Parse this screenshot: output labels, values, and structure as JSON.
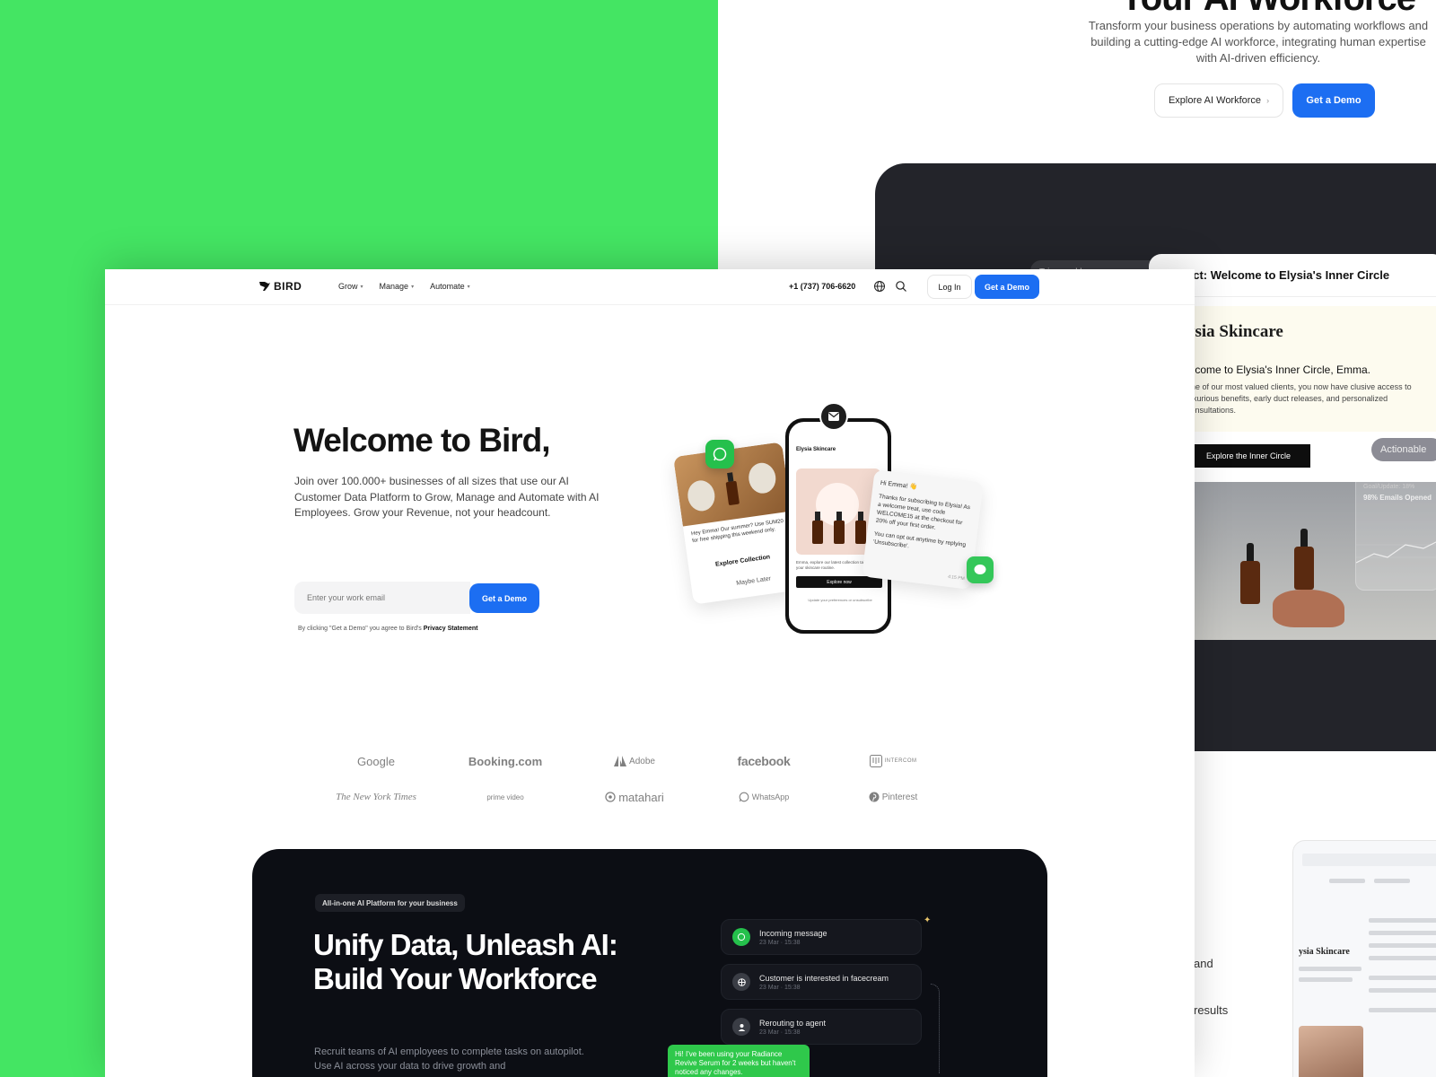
{
  "back_page": {
    "heading": "Your AI Workforce",
    "subtitle": "Transform your business operations by automating workflows and building a cutting-edge AI workforce, integrating human expertise with AI-driven efficiency.",
    "explore_label": "Explore AI Workforce",
    "demo_label": "Get a Demo",
    "email_preview": {
      "tab_label": "Triggered by",
      "subject": "ect: Welcome to Elysia's Inner Circle",
      "brand": "ysia Skincare",
      "welcome": "elcome to Elysia's Inner Circle, Emma.",
      "body": "one of our most valued clients, you now have clusive access to luxurious benefits, early duct releases, and personalized consultations.",
      "cta": "Explore the Inner Circle"
    },
    "actionable_pill": "Actionable",
    "stat_card": {
      "label": "Goal/Update: 18%",
      "value": "98% Emails Opened"
    },
    "lower_text_1": "and",
    "lower_text_2": "results",
    "panel_brand": "ysia Skincare"
  },
  "nav": {
    "logo": "BIRD",
    "menu": [
      {
        "label": "Grow"
      },
      {
        "label": "Manage"
      },
      {
        "label": "Automate"
      }
    ],
    "phone": "+1 (737) 706-6620",
    "login": "Log In",
    "demo": "Get a Demo"
  },
  "hero": {
    "title": "Welcome to Bird,",
    "subtitle": "Join over 100.000+ businesses of all sizes that use our AI Customer Data Platform to Grow, Manage and Automate with AI Employees. Grow your Revenue, not your headcount.",
    "email_placeholder": "Enter your work email",
    "button": "Get a Demo",
    "legal_prefix": "By clicking \"Get a Demo\" you agree to Bird's",
    "legal_link": "Privacy Statement"
  },
  "mockup": {
    "left_card_text": "Hey Emma! Our summer? Use SUM20 for free shipping this weekend only.",
    "left_card_link": "Explore Collection",
    "left_card_link2": "Maybe Later",
    "phone_sender": "Elysia Skincare",
    "phone_text": "Emma, explore our latest collection tailored to your skincare routine.",
    "phone_button": "Explore now",
    "phone_footer": "Update your preferences or unsubscribe",
    "right_card_hi": "Hi Emma! 👋",
    "right_card_body": "Thanks for subscribing to Elysia! As a welcome treat, use code WELCOME15 at the checkout for 20% off your first order.",
    "right_card_optout": "You can opt out anytime by replying 'Unsubscribe'.",
    "right_card_time": "4:15 PM"
  },
  "logos": [
    {
      "name": "Google"
    },
    {
      "name": "Booking.com"
    },
    {
      "name": "Adobe"
    },
    {
      "name": "facebook"
    },
    {
      "name": "INTERCOM"
    },
    {
      "name": "The New York Times"
    },
    {
      "name": "prime video"
    },
    {
      "name": "matahari"
    },
    {
      "name": "WhatsApp"
    },
    {
      "name": "Pinterest"
    }
  ],
  "platform": {
    "pill": "All-in-one AI Platform for your business",
    "title": "Unify Data, Unleash AI: Build Your Workforce",
    "subtitle": "Recruit teams of AI employees to complete tasks on autopilot. Use AI across your data to drive growth and",
    "events": [
      {
        "title": "Incoming message",
        "time": "23 Mar · 15:38",
        "icon": "whatsapp-icon",
        "color": "#25c04c"
      },
      {
        "title": "Customer is interested in facecream",
        "time": "23 Mar · 15:38",
        "icon": "openai-icon",
        "color": "#3a3d45"
      },
      {
        "title": "Rerouting to agent",
        "time": "23 Mar · 15:38",
        "icon": "agent-icon",
        "color": "#3a3d45"
      }
    ],
    "chat": "Hi! I've been using your Radiance Revive Serum for 2 weeks but haven't noticed any changes."
  },
  "colors": {
    "background": "#44e563",
    "accent": "#1c6ef2",
    "dark": "#0c0e14"
  }
}
